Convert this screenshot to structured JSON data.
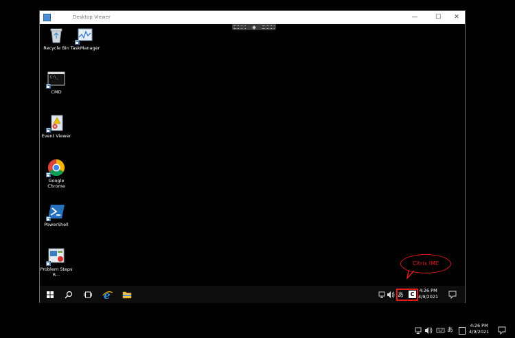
{
  "window": {
    "title": "Desktop Viewer",
    "minimize_glyph": "—",
    "maximize_glyph": "☐",
    "close_glyph": "✕"
  },
  "desktop_icons": [
    {
      "label": "Recycle Bin",
      "icon": "recycle-bin-icon"
    },
    {
      "label": "TaskManager",
      "icon": "task-manager-icon"
    },
    {
      "label": "CMD",
      "icon": "cmd-icon"
    },
    {
      "label": "Event Viewer",
      "icon": "event-viewer-icon"
    },
    {
      "label": "Google Chrome",
      "icon": "chrome-icon"
    },
    {
      "label": "PowerShell",
      "icon": "powershell-icon"
    },
    {
      "label": "Problem Steps R...",
      "icon": "problem-steps-recorder-icon"
    }
  ],
  "callout": {
    "text": "Citrix IME"
  },
  "inner_taskbar": {
    "ime_glyph": "あ",
    "citrix_glyph": "C",
    "time": "4:26 PM",
    "date": "4/9/2021"
  },
  "outer_taskbar": {
    "ime_glyph": "あ",
    "time": "4:26 PM",
    "date": "4/9/2021"
  },
  "colors": {
    "highlight": "#e21b1b",
    "windows_blue": "#4a8fd4"
  }
}
